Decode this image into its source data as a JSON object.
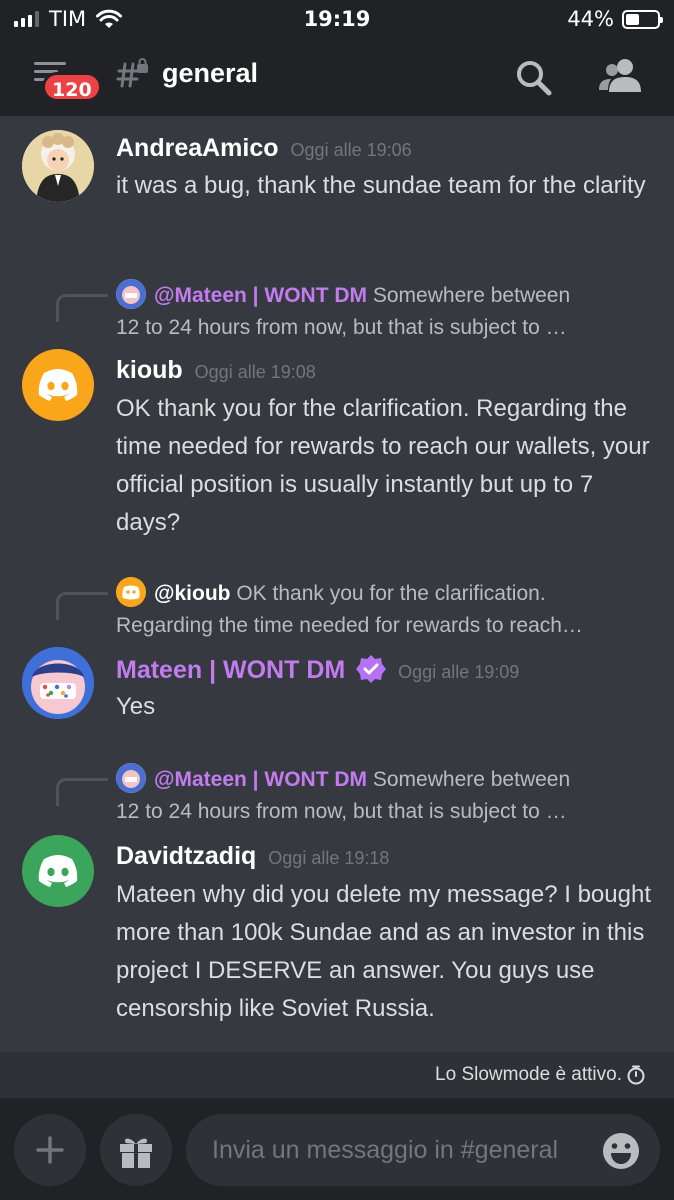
{
  "status_bar": {
    "carrier": "TIM",
    "time": "19:19",
    "battery": "44%",
    "battery_level": 0.44
  },
  "header": {
    "badge_count": "120",
    "channel_name": "general"
  },
  "messages": [
    {
      "author": "AndreaAmico",
      "timestamp": "Oggi alle 19:06",
      "text": "it was a bug, thank the sundae team for the clarity",
      "avatar_icon": "cartoon-avatar"
    },
    {
      "reply": {
        "mention": "@Mateen | WONT DM",
        "line1": "Somewhere between",
        "line2": "12 to 24 hours from now, but that is subject to …"
      },
      "author": "kioub",
      "timestamp": "Oggi alle 19:08",
      "text": "OK thank you for the clarification. Regarding the time needed for rewards to reach our wallets, your official position is usually instantly but up to 7 days?",
      "avatar_color": "#faa61a",
      "avatar_icon": "discord-icon"
    },
    {
      "reply": {
        "mention": "@kioub",
        "line1": "OK thank you for the clarification.",
        "line2": "Regarding the time needed for rewards to reach…"
      },
      "author": "Mateen | WONT DM",
      "timestamp": "Oggi alle 19:09",
      "text": "Yes",
      "author_color": "#c27cf0",
      "avatar_icon": "cartoon-avatar"
    },
    {
      "reply": {
        "mention": "@Mateen | WONT DM",
        "line1": "Somewhere between",
        "line2": "12 to 24 hours from now, but that is subject to …"
      },
      "author": "Davidtzadiq",
      "timestamp": "Oggi alle 19:18",
      "text": "Mateen why did you delete my message? I bought more than 100k Sundae and as an investor in this project I DESERVE an answer. You guys use censorship like Soviet Russia.",
      "avatar_color": "#3ba55c",
      "avatar_icon": "discord-icon"
    }
  ],
  "slowmode": {
    "text": "Lo Slowmode è attivo."
  },
  "composer": {
    "placeholder": "Invia un messaggio in #general"
  },
  "colors": {
    "background": "#36393f",
    "header": "#202225",
    "mention": "#c27cf0",
    "badge": "#ed4245"
  }
}
